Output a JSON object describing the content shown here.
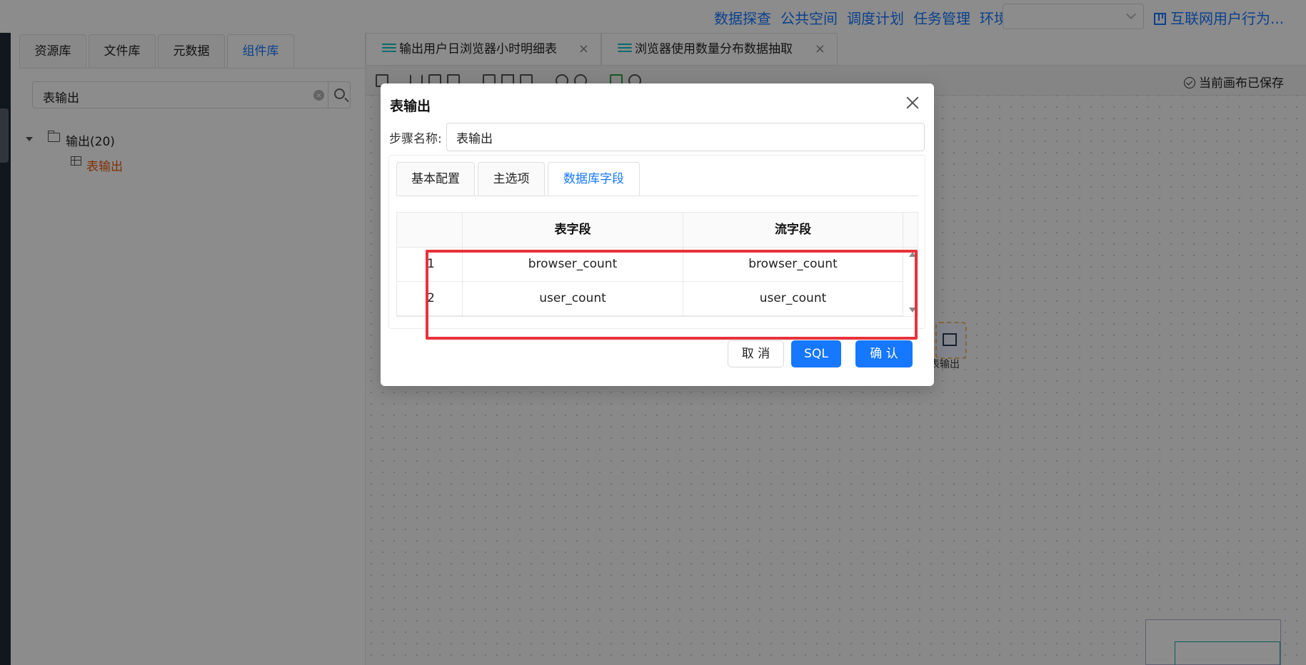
{
  "top_nav": {
    "items": [
      "数据探查",
      "公共空间",
      "调度计划",
      "任务管理",
      "环境管理"
    ],
    "env_select_value": "",
    "project_name": "互联网用户行为..."
  },
  "left_panel": {
    "tabs": [
      "资源库",
      "文件库",
      "元数据",
      "组件库"
    ],
    "active_tab": "组件库",
    "search_value": "表输出",
    "tree": {
      "folder_label": "输出(20)",
      "leaf_label": "表输出"
    }
  },
  "editor": {
    "tabs": [
      {
        "label": "输出用户日浏览器小时明细表"
      },
      {
        "label": "浏览器使用数量分布数据抽取"
      }
    ],
    "saved_status": "当前画布已保存",
    "node_label": "表输出"
  },
  "modal": {
    "title": "表输出",
    "step_name_label": "步骤名称:",
    "step_name_value": "表输出",
    "tabs": [
      "基本配置",
      "主选项",
      "数据库字段"
    ],
    "active_tab": "数据库字段",
    "table": {
      "headers": [
        "",
        "表字段",
        "流字段"
      ],
      "rows": [
        {
          "index": "1",
          "table_field": "browser_count",
          "stream_field": "browser_count"
        },
        {
          "index": "2",
          "table_field": "user_count",
          "stream_field": "user_count"
        }
      ]
    },
    "buttons": {
      "cancel": "取 消",
      "sql": "SQL",
      "confirm": "确 认"
    }
  },
  "colors": {
    "accent": "#1677ff",
    "highlight": "#e8323c",
    "tree_leaf": "#e8590c"
  }
}
